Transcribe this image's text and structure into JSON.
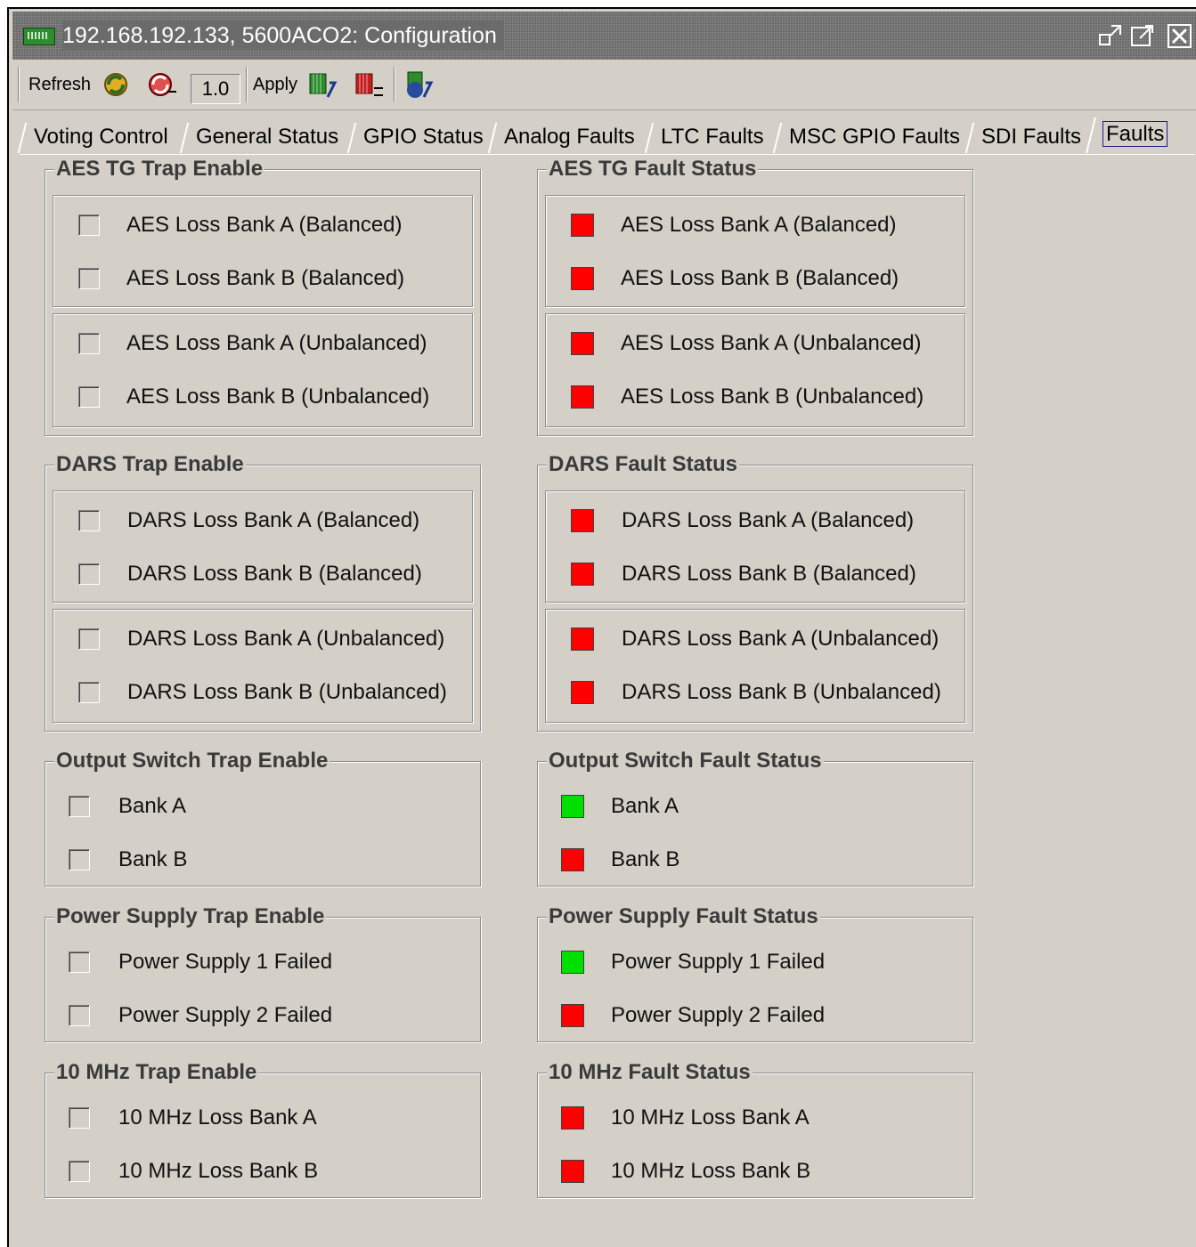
{
  "window": {
    "title": "192.168.192.133, 5600ACO2: Configuration",
    "controls": [
      "restore-icon",
      "maximize-icon",
      "close-icon"
    ]
  },
  "toolbar": {
    "refresh_label": "Refresh",
    "value": "1.0",
    "apply_label": "Apply"
  },
  "tabs": [
    {
      "label": "Voting Control",
      "active": false
    },
    {
      "label": "General Status",
      "active": false
    },
    {
      "label": "GPIO Status",
      "active": false
    },
    {
      "label": "Analog Faults",
      "active": false
    },
    {
      "label": "LTC Faults",
      "active": false
    },
    {
      "label": "MSC GPIO Faults",
      "active": false
    },
    {
      "label": "SDI Faults",
      "active": false
    },
    {
      "label": "Faults",
      "active": true
    }
  ],
  "colors": {
    "fault": "#ff0000",
    "ok": "#00e000"
  },
  "aes_trap": {
    "title": "AES TG Trap Enable",
    "items": [
      {
        "label": "AES Loss Bank A (Balanced)",
        "checked": false
      },
      {
        "label": "AES Loss Bank B (Balanced)",
        "checked": false
      },
      {
        "label": "AES Loss Bank A (Unbalanced)",
        "checked": false
      },
      {
        "label": "AES Loss Bank B (Unbalanced)",
        "checked": false
      }
    ]
  },
  "aes_status": {
    "title": "AES TG Fault Status",
    "items": [
      {
        "label": "AES Loss Bank A (Balanced)",
        "state": "fault"
      },
      {
        "label": "AES Loss Bank B (Balanced)",
        "state": "fault"
      },
      {
        "label": "AES Loss Bank A (Unbalanced)",
        "state": "fault"
      },
      {
        "label": "AES Loss Bank B (Unbalanced)",
        "state": "fault"
      }
    ]
  },
  "dars_trap": {
    "title": "DARS Trap Enable",
    "items": [
      {
        "label": "DARS Loss Bank A (Balanced)",
        "checked": false
      },
      {
        "label": "DARS Loss Bank B (Balanced)",
        "checked": false
      },
      {
        "label": "DARS Loss Bank A (Unbalanced)",
        "checked": false
      },
      {
        "label": "DARS Loss Bank B (Unbalanced)",
        "checked": false
      }
    ]
  },
  "dars_status": {
    "title": "DARS Fault Status",
    "items": [
      {
        "label": "DARS Loss Bank A (Balanced)",
        "state": "fault"
      },
      {
        "label": "DARS Loss Bank B (Balanced)",
        "state": "fault"
      },
      {
        "label": "DARS Loss Bank A (Unbalanced)",
        "state": "fault"
      },
      {
        "label": "DARS Loss Bank B (Unbalanced)",
        "state": "fault"
      }
    ]
  },
  "output_trap": {
    "title": "Output Switch Trap Enable",
    "items": [
      {
        "label": "Bank A",
        "checked": false
      },
      {
        "label": "Bank B",
        "checked": false
      }
    ]
  },
  "output_status": {
    "title": "Output Switch Fault Status",
    "items": [
      {
        "label": "Bank A",
        "state": "ok"
      },
      {
        "label": "Bank B",
        "state": "fault"
      }
    ]
  },
  "power_trap": {
    "title": "Power Supply Trap Enable",
    "items": [
      {
        "label": "Power Supply 1 Failed",
        "checked": false
      },
      {
        "label": "Power Supply 2 Failed",
        "checked": false
      }
    ]
  },
  "power_status": {
    "title": "Power Supply Fault Status",
    "items": [
      {
        "label": "Power Supply 1 Failed",
        "state": "ok"
      },
      {
        "label": "Power Supply 2 Failed",
        "state": "fault"
      }
    ]
  },
  "mhz_trap": {
    "title": "10 MHz Trap Enable",
    "items": [
      {
        "label": "10 MHz Loss Bank A",
        "checked": false
      },
      {
        "label": "10 MHz Loss Bank B",
        "checked": false
      }
    ]
  },
  "mhz_status": {
    "title": "10 MHz Fault Status",
    "items": [
      {
        "label": "10 MHz Loss Bank A",
        "state": "fault"
      },
      {
        "label": "10 MHz Loss Bank B",
        "state": "fault"
      }
    ]
  }
}
